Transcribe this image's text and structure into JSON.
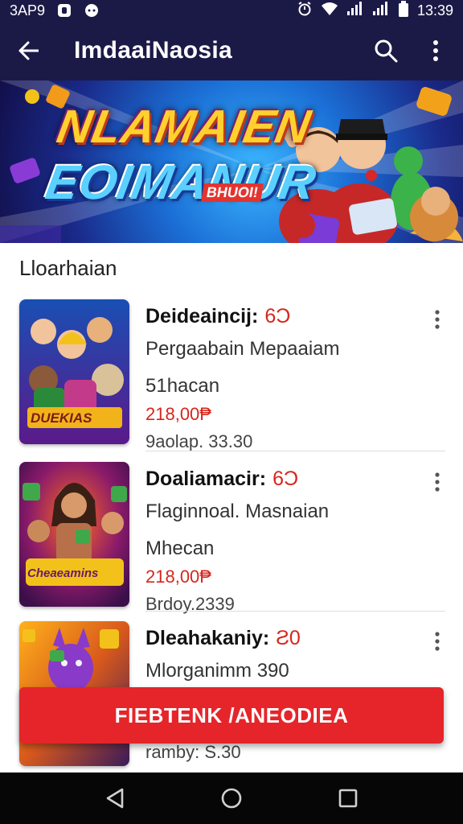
{
  "status_bar": {
    "carrier": "3AP9",
    "time": "13:39",
    "icons": [
      "notification-icon",
      "chat-icon",
      "alarm-icon",
      "wifi-icon",
      "signal-icon",
      "signal-icon",
      "battery-icon"
    ]
  },
  "app_bar": {
    "title": "ImdaaiNaosia",
    "icons": [
      "back-arrow-icon",
      "search-icon",
      "more-vert-icon"
    ]
  },
  "banner": {
    "line1": "NLAMAIEN",
    "line2": "EOIMANUR",
    "tag": "BHUOI!"
  },
  "section": {
    "title": "Lloarhaian"
  },
  "items": [
    {
      "name": "Deideaincij:",
      "badge": "6Ɔ",
      "subtitle": "Pergaabain Mepaaiam",
      "meta": "51hacan",
      "price": "218,00₱",
      "extra": "9aolap. 33.30",
      "thumb_text": "DUEKIAS",
      "thumb_colors": [
        "#1a4fb3",
        "#f2b21a",
        "#c43a8a"
      ]
    },
    {
      "name": "Doaliamacir:",
      "badge": "6Ɔ",
      "subtitle": "Flaginnoal. Masnaian",
      "meta": "Mhecan",
      "price": "218,00₱",
      "extra": "Brdoy.2339",
      "thumb_text": "Cheaeamins",
      "thumb_colors": [
        "#6a1a6a",
        "#ff5a1f",
        "#3fa84a"
      ]
    },
    {
      "name": "Dleahakaniy:",
      "badge": "Ƨ0",
      "subtitle": "Mlorganimm 390",
      "meta": "",
      "price": "",
      "extra": "ramby: S.30",
      "thumb_text": "",
      "thumb_colors": [
        "#d8591c",
        "#7a2aa8",
        "#f2c21a"
      ]
    }
  ],
  "cta": {
    "label": "FIEBTENK /ANEODIEA"
  },
  "nav_bar": {
    "icons": [
      "nav-back-icon",
      "nav-home-icon",
      "nav-recents-icon"
    ]
  },
  "colors": {
    "header": "#1b1a47",
    "accent": "#e5252a",
    "price": "#d7261c"
  }
}
